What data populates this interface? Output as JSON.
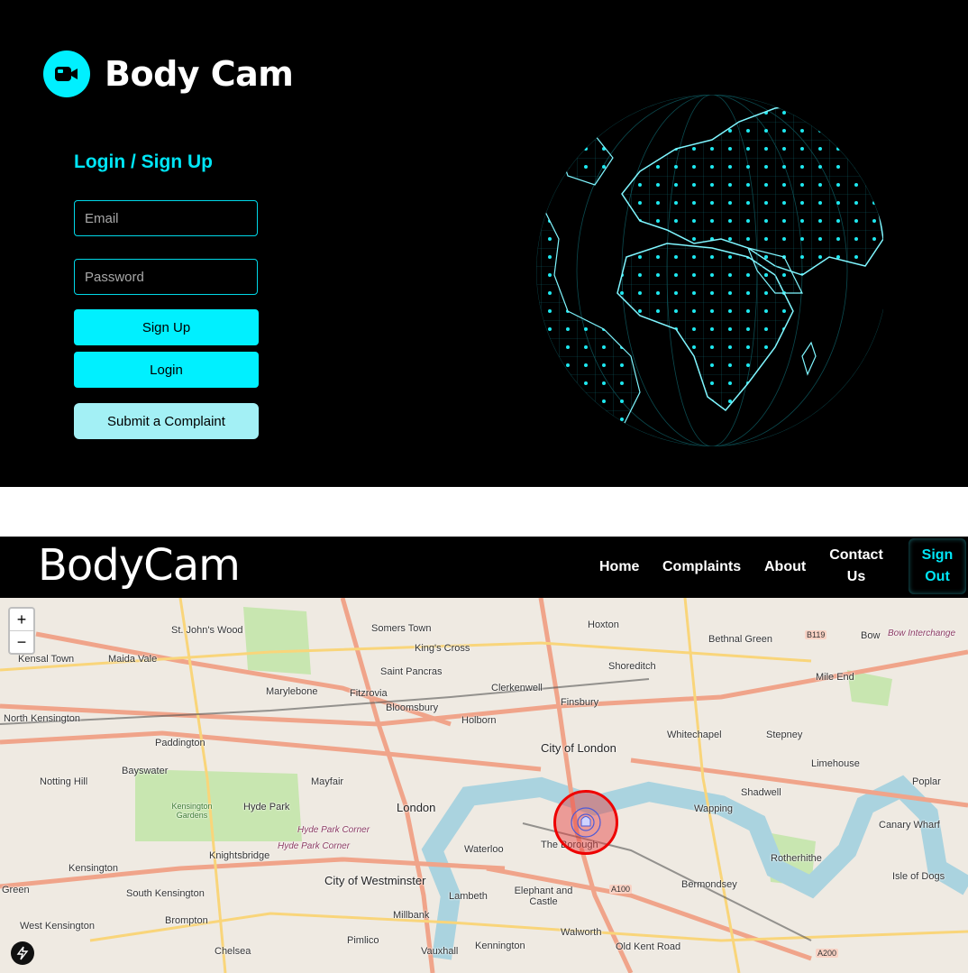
{
  "login": {
    "brand_title": "Body Cam",
    "brand_icon": "video-camera-icon",
    "form_title": "Login / Sign Up",
    "email_placeholder": "Email",
    "password_placeholder": "Password",
    "signup_label": "Sign Up",
    "login_label": "Login",
    "complaint_label": "Submit a Complaint",
    "accent_color": "#00f0ff"
  },
  "navbar": {
    "title": "BodyCam",
    "links": {
      "home": "Home",
      "complaints": "Complaints",
      "about": "About",
      "contact": "Contact Us",
      "signout": "Sign Out"
    }
  },
  "map": {
    "zoom_in": "+",
    "zoom_out": "−",
    "marker_color": "#e00000",
    "labels": {
      "st_johns_wood": "St. John's Wood",
      "somers_town": "Somers Town",
      "hoxton": "Hoxton",
      "bethnal_green": "Bethnal Green",
      "bow": "Bow",
      "bow_interchange": "Bow Interchange",
      "kings_cross": "King's Cross",
      "kensal_town": "Kensal Town",
      "maida_vale": "Maida Vale",
      "saint_pancras": "Saint Pancras",
      "shoreditch": "Shoreditch",
      "mile_end": "Mile End",
      "marylebone": "Marylebone",
      "fitzrovia": "Fitzrovia",
      "clerkenwell": "Clerkenwell",
      "bloomsbury": "Bloomsbury",
      "finsbury": "Finsbury",
      "north_kensington": "North Kensington",
      "holborn": "Holborn",
      "paddington": "Paddington",
      "whitechapel": "Whitechapel",
      "stepney": "Stepney",
      "city_of_london": "City of London",
      "bayswater": "Bayswater",
      "notting_hill": "Notting Hill",
      "limehouse": "Limehouse",
      "poplar": "Poplar",
      "mayfair": "Mayfair",
      "shadwell": "Shadwell",
      "hyde_park": "Hyde Park",
      "kensington_gardens": "Kensington Gardens",
      "london": "London",
      "wapping": "Wapping",
      "canary_wharf": "Canary Wharf",
      "hyde_park_corner": "Hyde Park Corner",
      "knightsbridge": "Knightsbridge",
      "waterloo": "Waterloo",
      "the_borough": "The Borough",
      "rotherhithe": "Rotherhithe",
      "kensington": "Kensington",
      "city_of_westminster": "City of Westminster",
      "isle_of_dogs": "Isle of Dogs",
      "green": "Green",
      "south_kensington": "South Kensington",
      "lambeth": "Lambeth",
      "elephant_and_castle": "Elephant and Castle",
      "a100": "A100",
      "bermondsey": "Bermondsey",
      "brompton": "Brompton",
      "millbank": "Millbank",
      "west_kensington": "West Kensington",
      "pimlico": "Pimlico",
      "walworth": "Walworth",
      "chelsea": "Chelsea",
      "vauxhall": "Vauxhall",
      "kennington": "Kennington",
      "old_kent_road": "Old Kent Road",
      "a200": "A200",
      "b119": "B119"
    }
  }
}
